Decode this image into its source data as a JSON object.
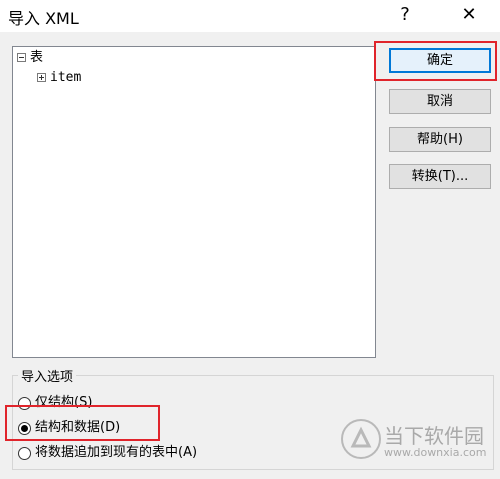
{
  "window": {
    "title": "导入 XML",
    "help_label": "?",
    "close_label": "✕"
  },
  "tree": {
    "root": {
      "expander": "minus",
      "label": "表"
    },
    "child": {
      "expander": "plus",
      "label": "item"
    }
  },
  "buttons": {
    "ok": "确定",
    "cancel": "取消",
    "help": "帮助(H)",
    "transform": "转换(T)..."
  },
  "options": {
    "title": "导入选项",
    "items": [
      {
        "label": "仅结构(S)",
        "checked": false
      },
      {
        "label": "结构和数据(D)",
        "checked": true
      },
      {
        "label": "将数据追加到现有的表中(A)",
        "checked": false
      }
    ]
  },
  "watermark": {
    "brand": "当下软件园",
    "url": "www.downxia.com"
  },
  "colors": {
    "highlight": "#e0242b",
    "accent": "#0078d7"
  }
}
